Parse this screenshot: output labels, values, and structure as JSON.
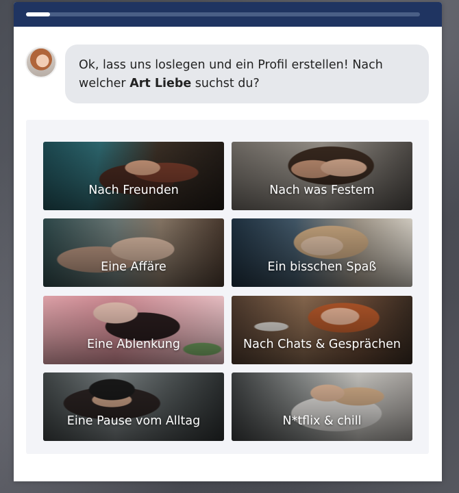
{
  "progress": {
    "fraction": 0.06
  },
  "chat": {
    "avatar_alt": "avatar",
    "message_part1": "Ok, lass uns loslegen und ein Profil erstellen! Nach welcher ",
    "message_bold": "Art Liebe",
    "message_part2": " suchst du?"
  },
  "options": [
    {
      "label": "Nach Freunden"
    },
    {
      "label": "Nach was Festem"
    },
    {
      "label": "Eine Affäre"
    },
    {
      "label": "Ein bisschen Spaß"
    },
    {
      "label": "Eine Ablenkung"
    },
    {
      "label": "Nach Chats & Gesprächen"
    },
    {
      "label": "Eine Pause vom Alltag"
    },
    {
      "label": "N*tflix & chill"
    }
  ],
  "colors": {
    "header": "#1f3461",
    "bubble": "#e6e8ec",
    "panel": "#f3f4f8"
  }
}
